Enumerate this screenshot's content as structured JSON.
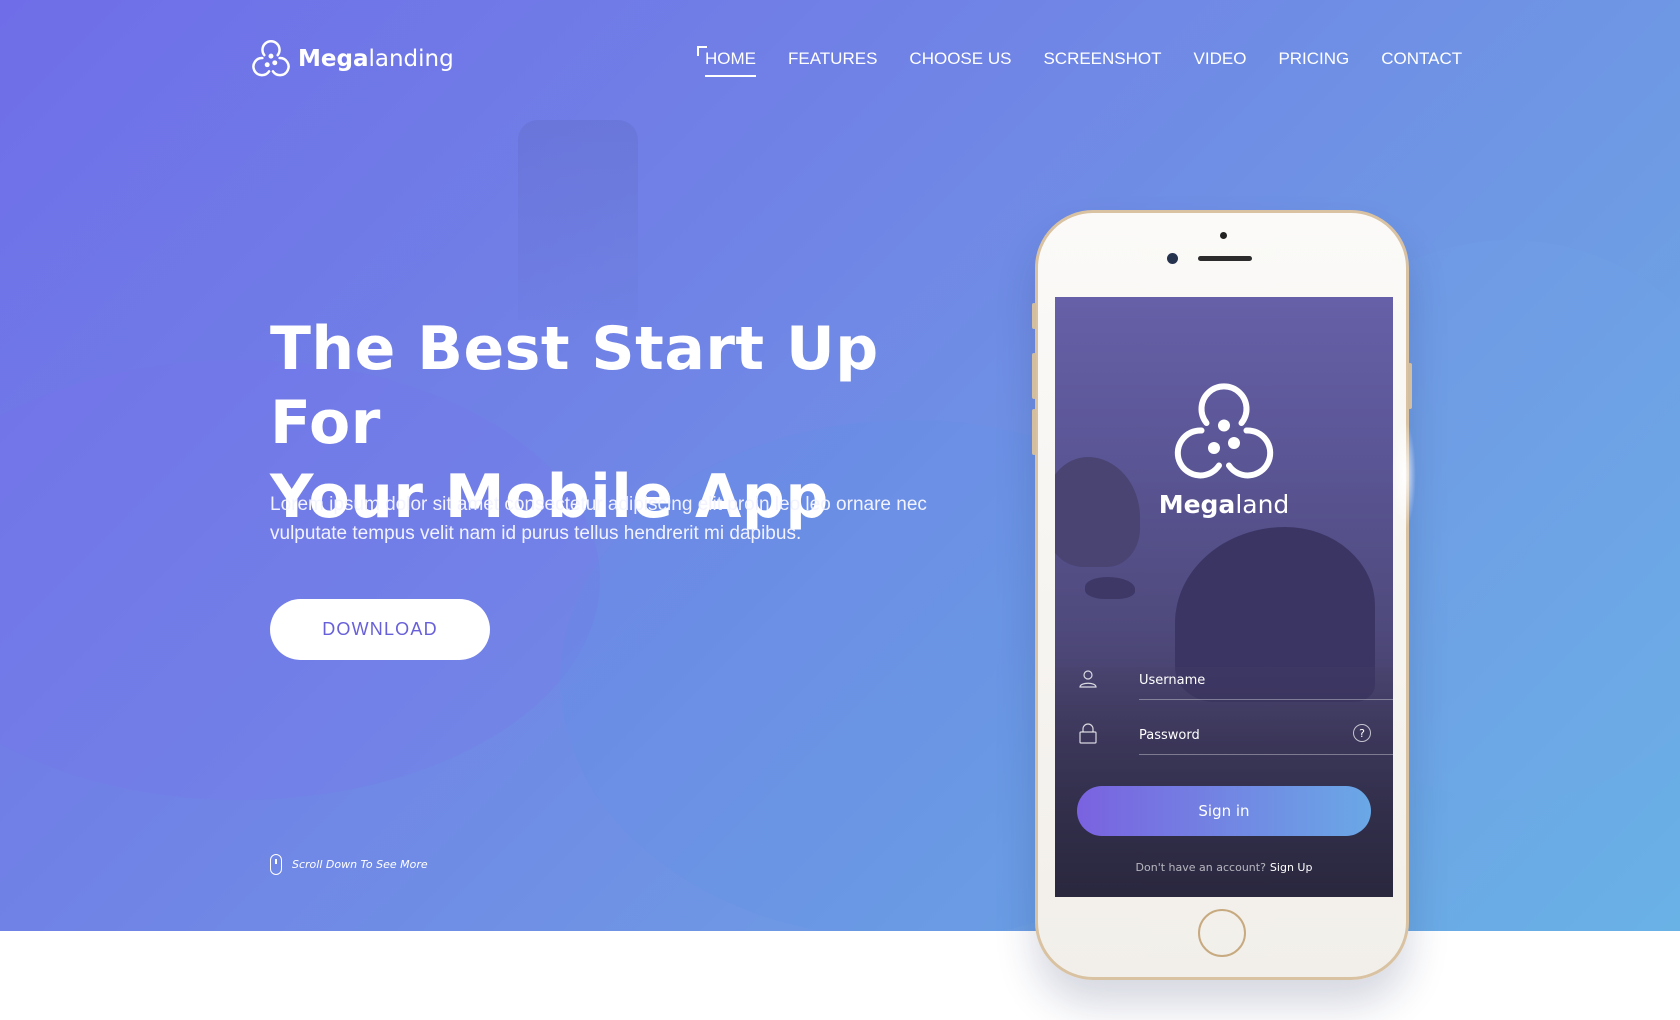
{
  "brand": {
    "name_bold": "Mega",
    "name_light": "landing",
    "icon": "megalanding-logo-icon"
  },
  "nav": {
    "items": [
      {
        "label": "HOME",
        "active": true
      },
      {
        "label": "FEATURES"
      },
      {
        "label": "CHOOSE US"
      },
      {
        "label": "SCREENSHOT"
      },
      {
        "label": "VIDEO"
      },
      {
        "label": "PRICING"
      },
      {
        "label": "CONTACT"
      }
    ]
  },
  "hero": {
    "headline_line1": "The Best Start Up For",
    "headline_line2": "Your Mobile App",
    "subtext": "Lorem ipsum dolor sit amet consectetur adipiscing elit proin leo leo ornare nec vulputate tempus velit nam id purus tellus hendrerit mi dapibus.",
    "download_label": "DOWNLOAD",
    "scroll_hint": "Scroll Down To See More"
  },
  "phone_app": {
    "name_bold": "Mega",
    "name_light": "land",
    "username_label": "Username",
    "password_label": "Password",
    "help_glyph": "?",
    "signin_label": "Sign in",
    "signup_question": "Don't have an account?",
    "signup_link": "Sign Up"
  },
  "colors": {
    "gradient_start": "#6f6ee8",
    "gradient_end": "#69b2e6",
    "accent": "#6860d8",
    "phone_frame": "#d9c2a2"
  }
}
